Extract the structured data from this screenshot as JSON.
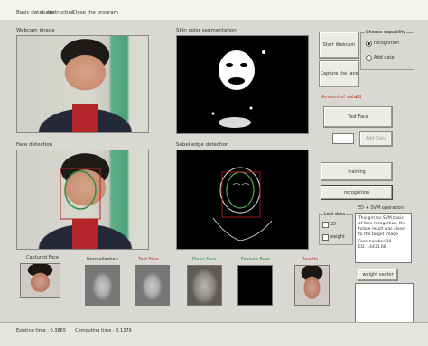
{
  "menu": {
    "items": [
      "Basic database",
      "Instruction",
      "Close the program"
    ]
  },
  "panels": {
    "webcam_label": "Webcam image",
    "skin_label": "Skin color segmentation",
    "face_detect_label": "Face detection",
    "sobel_label": "Sobel edge detection"
  },
  "buttons": {
    "start_webcam": "Start Webcam",
    "capture_face": "Capture the face",
    "test_face": "Test Face",
    "add_data": "Add Data",
    "training": "training",
    "recognition": "recognition",
    "weight_vector": "weight vector"
  },
  "capability": {
    "legend": "Choose capability",
    "recognition_label": "recognition",
    "add_data_label": "Add data"
  },
  "amount": {
    "label": "Amount of data :",
    "value": "88"
  },
  "distance": {
    "legend": "Lost data",
    "ed_label": "ED",
    "weight_label": "weight"
  },
  "operation": {
    "title": "ED + SVM operation",
    "text": "This girl for SVM basic of face recognition, the follow result was closer to the target image",
    "face_number": "Face number:38",
    "value_line": "ED: 14431.68"
  },
  "thumbs": {
    "captured": "Captured Face",
    "normalization": "Normalization",
    "test": "Test Face",
    "mean": "Mean Face",
    "feature": "Feature Face",
    "results": "Results"
  },
  "thumb_colors": {
    "test": "#c0392b",
    "mean": "#1a9b6b",
    "feature": "#2e8b3a",
    "results": "#c0392b"
  },
  "status": {
    "existing": "Existing time : 0.3865",
    "computing": "Computing time : 0.1379"
  }
}
